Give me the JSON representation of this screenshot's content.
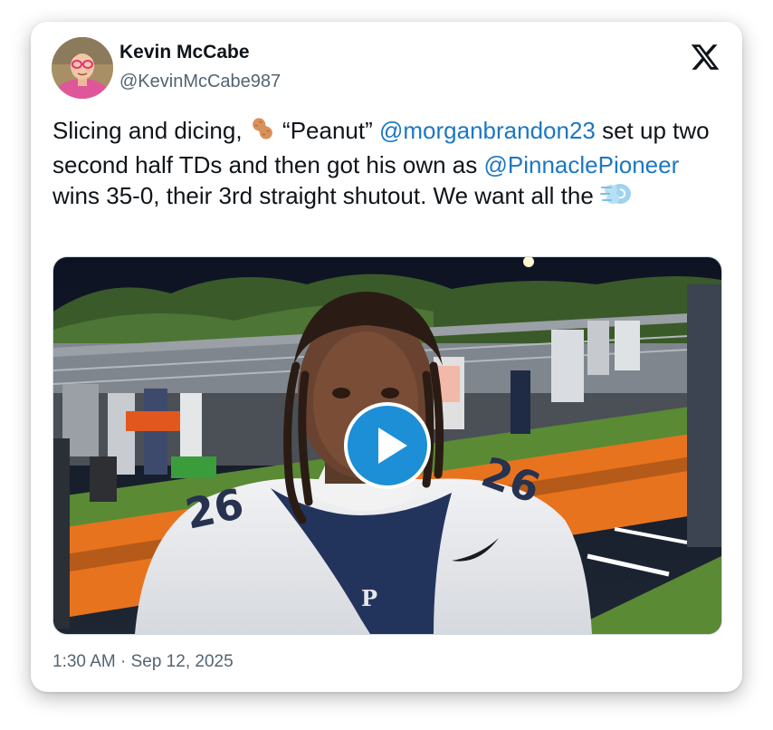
{
  "tweet": {
    "author": {
      "display_name": "Kevin McCabe",
      "handle": "@KevinMcCabe987",
      "avatar_icon": "profile-photo"
    },
    "brand_icon": "x-logo-icon",
    "text": {
      "part1": "Slicing and dicing, ",
      "emoji_peanut": "🥜",
      "part2": " “Peanut” ",
      "mention1": "@morganbrandon23",
      "part3": " set up two second half TDs and then got his own as ",
      "mention2": "@PinnaclePioneer",
      "part4": " wins 35-0, their 3rd straight shutout. We want all the ",
      "emoji_dash": "💨"
    },
    "media": {
      "type": "video",
      "play_icon": "play-icon"
    },
    "timestamp": "1:30 AM · Sep 12, 2025"
  },
  "colors": {
    "link": "#1d77c2",
    "text": "#0f1419",
    "secondary": "#536471",
    "play": "#1d8fd6"
  }
}
